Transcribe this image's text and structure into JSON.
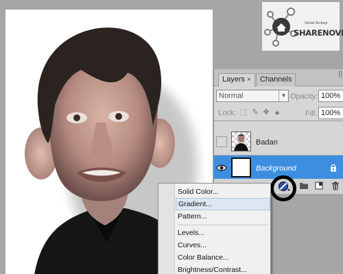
{
  "watermark": {
    "brand": "SHARENOVEL",
    "tagline": "Sebab Berbagi"
  },
  "layers_panel": {
    "tabs": [
      {
        "label": "Layers",
        "close": "×"
      },
      {
        "label": "Channels"
      }
    ],
    "blend_mode": "Normal",
    "opacity_label": "Opacity:",
    "opacity_value": "100%",
    "lock_label": "Lock:",
    "fill_label": "Fill:",
    "fill_value": "100%",
    "layers": [
      {
        "name": "Badan",
        "visible": false
      },
      {
        "name": "Background",
        "visible": true,
        "selected": true,
        "locked": true
      }
    ],
    "highlight_color": "#3d8ee0",
    "bottom_icons": [
      "link-icon",
      "fx-icon",
      "mask-icon",
      "adjustment-layer-icon",
      "group-folder-icon",
      "new-layer-icon",
      "trash-icon"
    ]
  },
  "adjustment_menu": {
    "items": [
      {
        "label": "Solid Color..."
      },
      {
        "label": "Gradient...",
        "hover": true
      },
      {
        "label": "Pattern..."
      },
      {
        "label": "Levels..."
      },
      {
        "label": "Curves..."
      },
      {
        "label": "Color Balance..."
      },
      {
        "label": "Brightness/Contrast..."
      }
    ]
  }
}
